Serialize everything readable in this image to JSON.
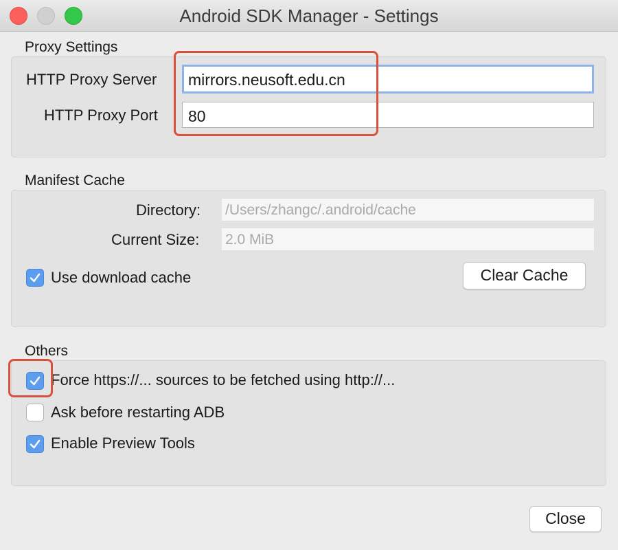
{
  "window": {
    "title": "Android SDK Manager - Settings"
  },
  "proxy": {
    "section_label": "Proxy Settings",
    "server_label": "HTTP Proxy Server",
    "server_value": "mirrors.neusoft.edu.cn",
    "port_label": "HTTP Proxy Port",
    "port_value": "80"
  },
  "cache": {
    "section_label": "Manifest Cache",
    "directory_label": "Directory:",
    "directory_value": "/Users/zhangc/.android/cache",
    "size_label": "Current Size:",
    "size_value": "2.0 MiB",
    "use_cache_label": "Use download cache",
    "use_cache_checked": true,
    "clear_button": "Clear Cache"
  },
  "others": {
    "section_label": "Others",
    "items": [
      {
        "label": "Force https://... sources to be fetched using http://...",
        "checked": true
      },
      {
        "label": "Ask before restarting ADB",
        "checked": false
      },
      {
        "label": "Enable Preview Tools",
        "checked": true
      }
    ]
  },
  "footer": {
    "close_button": "Close"
  },
  "colors": {
    "accent_checkbox": "#5c9df0",
    "annotation_highlight": "#d9503f",
    "focus_ring": "#8db3e8"
  },
  "icons": {
    "checkmark": "checkmark-icon"
  }
}
